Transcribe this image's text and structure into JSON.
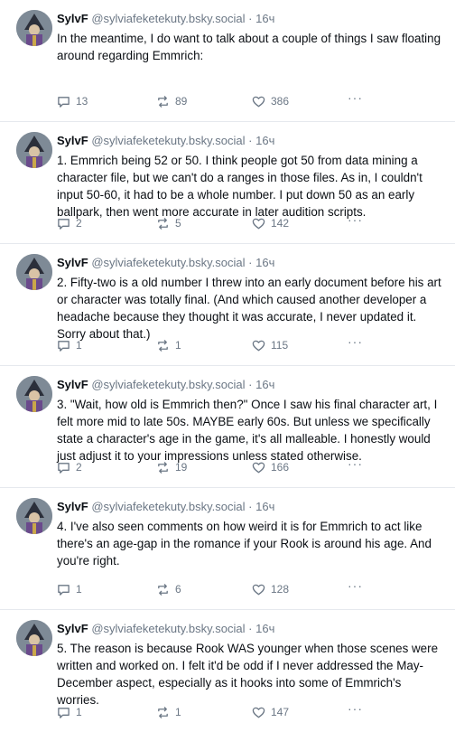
{
  "posts": [
    {
      "author": "SylvF",
      "handle": "@sylviafeketekuty.bsky.social",
      "separator": "·",
      "time": "16ч",
      "text": "In the meantime, I do want to talk about a couple of things I saw floating around regarding Emmrich:",
      "replies": "13",
      "reposts": "89",
      "likes": "386",
      "more": "···"
    },
    {
      "author": "SylvF",
      "handle": "@sylviafeketekuty.bsky.social",
      "separator": "·",
      "time": "16ч",
      "text": "1. Emmrich being 52 or 50. I think people got 50 from data mining a character file, but we can't do a ranges in those files. As in, I couldn't input 50-60, it had to be a whole number. I put down 50 as an early ballpark, then went more accurate in later audition scripts.",
      "replies": "2",
      "reposts": "5",
      "likes": "142",
      "more": "···"
    },
    {
      "author": "SylvF",
      "handle": "@sylviafeketekuty.bsky.social",
      "separator": "·",
      "time": "16ч",
      "text": "2. Fifty-two is a old number I threw into an early document before his art or character was totally final. (And which caused another developer a headache because they thought it was accurate, I never updated it. Sorry about that.)",
      "replies": "1",
      "reposts": "1",
      "likes": "115",
      "more": "···"
    },
    {
      "author": "SylvF",
      "handle": "@sylviafeketekuty.bsky.social",
      "separator": "·",
      "time": "16ч",
      "text": "3. \"Wait, how old is Emmrich then?\" Once I saw his final character art, I felt more mid to late 50s. MAYBE early 60s. But unless we specifically state a character's age in the game, it's all malleable. I honestly would just adjust it to your impressions unless stated otherwise.",
      "replies": "2",
      "reposts": "19",
      "likes": "166",
      "more": "···"
    },
    {
      "author": "SylvF",
      "handle": "@sylviafeketekuty.bsky.social",
      "separator": "·",
      "time": "16ч",
      "text": "4. I've also seen comments on how weird it is for Emmrich to act like there's an age-gap in the romance if your Rook is around his age. And you're right.",
      "replies": "1",
      "reposts": "6",
      "likes": "128",
      "more": "···"
    },
    {
      "author": "SylvF",
      "handle": "@sylviafeketekuty.bsky.social",
      "separator": "·",
      "time": "16ч",
      "text": "5. The reason is because Rook WAS younger when those scenes were written and worked on. I felt it'd be odd if I never addressed the May-December aspect, especially as it hooks into some of Emmrich's worries.",
      "replies": "1",
      "reposts": "1",
      "likes": "147",
      "more": "···"
    }
  ],
  "icons": {
    "reply": "reply-icon",
    "repost": "repost-icon",
    "like": "heart-icon",
    "more": "more-icon"
  },
  "colors": {
    "text": "#0b0f14",
    "muted": "#6b7785",
    "divider": "#e6e9ee"
  }
}
